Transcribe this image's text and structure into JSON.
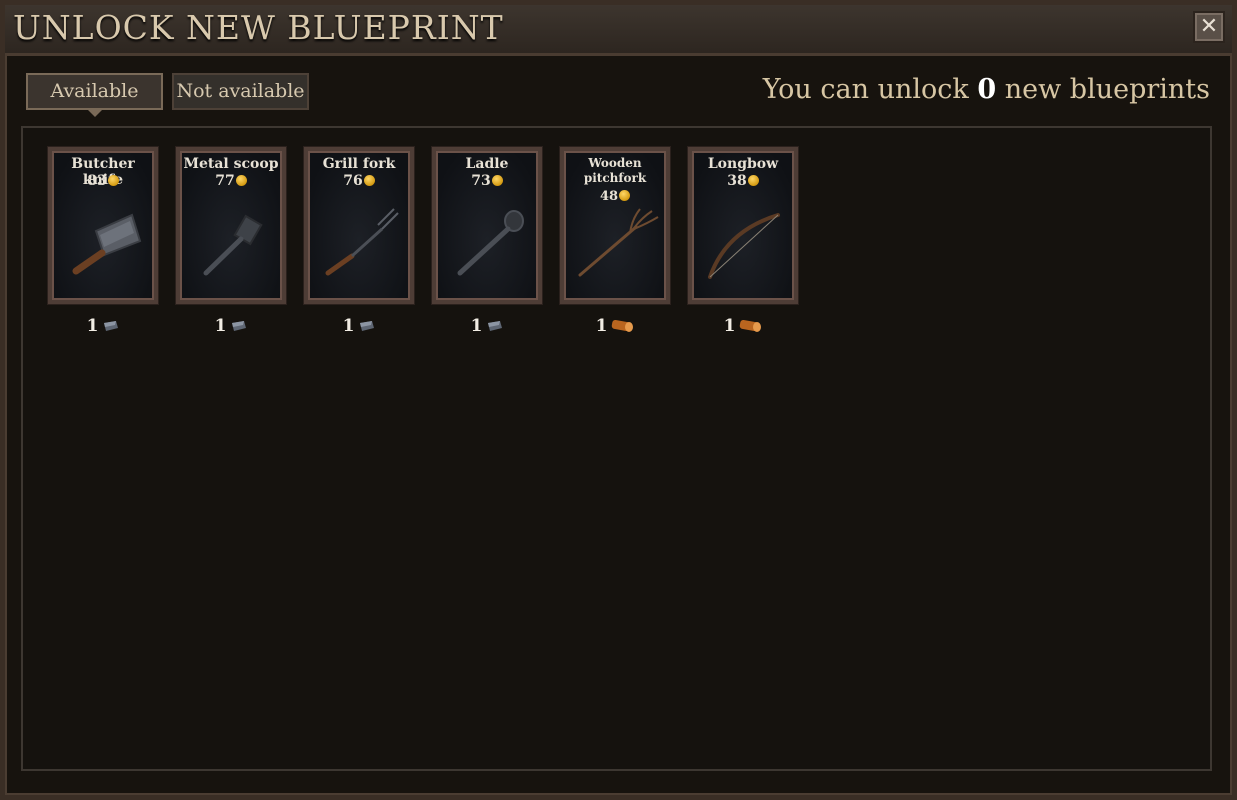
{
  "window": {
    "title": "UNLOCK NEW BLUEPRINT"
  },
  "tabs": [
    {
      "label": "Available",
      "active": true
    },
    {
      "label": "Not available",
      "active": false
    }
  ],
  "unlock_info": {
    "prefix": "You can unlock",
    "count": "0",
    "suffix": "new blueprints"
  },
  "blueprints": [
    {
      "name": "Butcher knife",
      "price": "83",
      "cost_qty": "1",
      "cost_material": "iron-ingot-icon",
      "art": "cleaver-icon"
    },
    {
      "name": "Metal scoop",
      "price": "77",
      "cost_qty": "1",
      "cost_material": "iron-ingot-icon",
      "art": "scoop-icon"
    },
    {
      "name": "Grill fork",
      "price": "76",
      "cost_qty": "1",
      "cost_material": "iron-ingot-icon",
      "art": "fork-icon"
    },
    {
      "name": "Ladle",
      "price": "73",
      "cost_qty": "1",
      "cost_material": "iron-ingot-icon",
      "art": "ladle-icon"
    },
    {
      "name": "Wooden pitchfork",
      "price": "48",
      "cost_qty": "1",
      "cost_material": "wood-log-icon",
      "art": "pitchfork-icon"
    },
    {
      "name": "Longbow",
      "price": "38",
      "cost_qty": "1",
      "cost_material": "wood-log-icon",
      "art": "bow-icon"
    }
  ],
  "icons": {
    "close": "close-icon",
    "currency": "gold-coin-icon"
  },
  "colors": {
    "accent_text": "#d7c6a4",
    "coin": "#e0a81c",
    "wood": "#c8752b",
    "iron": "#5a6270"
  }
}
